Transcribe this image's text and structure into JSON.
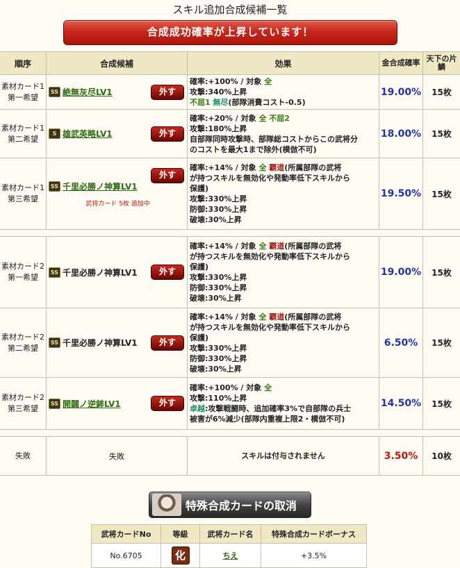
{
  "page": {
    "title": "スキル追加合成候補一覧",
    "banner": "合成成功確率が上昇しています！"
  },
  "headers": {
    "order": "順序",
    "candidate": "合成候補",
    "effect": "効果",
    "rate": "合成確率",
    "rate_prefix": "金",
    "slots": "天下の片鱗"
  },
  "rows": [
    {
      "order1": "素材カード1",
      "order2": "第一希望",
      "rank": "SS",
      "skill": "絶無灰尽LV1",
      "remove": "外す",
      "effect_lines": [
        [
          {
            "t": "確率:+100% / 対象 "
          },
          {
            "t": "全",
            "c": "g"
          }
        ],
        [
          {
            "t": "攻撃:340%上昇"
          }
        ],
        [
          {
            "t": "不屈1",
            "c": "g"
          },
          {
            "t": " "
          },
          {
            "t": "無尽",
            "c": "t"
          },
          {
            "t": "(部隊消費コスト-0.5)"
          }
        ]
      ],
      "rate": "19.00%",
      "slots": "15枚"
    },
    {
      "order1": "素材カード1",
      "order2": "第二希望",
      "rank": "S",
      "skill": "雄武英略LV1",
      "remove": "外す",
      "effect_lines": [
        [
          {
            "t": "確率:+20% / 対象 "
          },
          {
            "t": "全",
            "c": "g"
          },
          {
            "t": " "
          },
          {
            "t": "不屈2",
            "c": "g"
          }
        ],
        [
          {
            "t": "攻撃:180%上昇"
          }
        ],
        [
          {
            "t": "自部隊同時攻撃時、部隊総コストからこの武将分"
          }
        ],
        [
          {
            "t": "のコストを最大1まで除外(模倣不可)"
          }
        ]
      ],
      "rate": "18.00%",
      "slots": "15枚"
    },
    {
      "order1": "素材カード1",
      "order2": "第三希望",
      "rank": "SS",
      "skill": "千里必勝ノ神算LV1",
      "remove": "外す",
      "note": "武将カード 5枚 追加中",
      "effect_lines": [
        [
          {
            "t": "確率:+14% / 対象 "
          },
          {
            "t": "全",
            "c": "g"
          },
          {
            "t": " "
          },
          {
            "t": "覇道",
            "c": "r"
          },
          {
            "t": "(所属部隊の武将"
          }
        ],
        [
          {
            "t": "が持つスキルを無効化や発動率低下スキルから"
          }
        ],
        [
          {
            "t": "保護)"
          }
        ],
        [
          {
            "t": "攻撃:330%上昇"
          }
        ],
        [
          {
            "t": "防御:330%上昇"
          }
        ],
        [
          {
            "t": "破壊:30%上昇"
          }
        ]
      ],
      "rate": "19.50%",
      "slots": "15枚"
    },
    {
      "order1": "素材カード2",
      "order2": "第一希望",
      "rank": "SS",
      "skill": "千里必勝ノ神算LV1",
      "remove": "外す",
      "effect_lines": [
        [
          {
            "t": "確率:+14% / 対象 "
          },
          {
            "t": "全",
            "c": "g"
          },
          {
            "t": " "
          },
          {
            "t": "覇道",
            "c": "r"
          },
          {
            "t": "(所属部隊の武将"
          }
        ],
        [
          {
            "t": "が持つスキルを無効化や発動率低下スキルから"
          }
        ],
        [
          {
            "t": "保護)"
          }
        ],
        [
          {
            "t": "攻撃:330%上昇"
          }
        ],
        [
          {
            "t": "防御:330%上昇"
          }
        ],
        [
          {
            "t": "破壊:30%上昇"
          }
        ]
      ],
      "rate": "19.00%",
      "slots": "15枚"
    },
    {
      "order1": "素材カード2",
      "order2": "第二希望",
      "rank": "SS",
      "skill": "千里必勝ノ神算LV1",
      "remove": "外す",
      "effect_lines": [
        [
          {
            "t": "確率:+14% / 対象 "
          },
          {
            "t": "全",
            "c": "g"
          },
          {
            "t": " "
          },
          {
            "t": "覇道",
            "c": "r"
          },
          {
            "t": "(所属部隊の武将"
          }
        ],
        [
          {
            "t": "が持つスキルを無効化や発動率低下スキルから"
          }
        ],
        [
          {
            "t": "保護)"
          }
        ],
        [
          {
            "t": "攻撃:330%上昇"
          }
        ],
        [
          {
            "t": "防御:330%上昇"
          }
        ],
        [
          {
            "t": "破壊:30%上昇"
          }
        ]
      ],
      "rate": "6.50%",
      "slots": "15枚"
    },
    {
      "order1": "素材カード2",
      "order2": "第三希望",
      "rank": "SS",
      "skill": "開闢ノ逆鉾LV1",
      "remove": "外す",
      "effect_lines": [
        [
          {
            "t": "確率:+100% / 対象 "
          },
          {
            "t": "全",
            "c": "g"
          }
        ],
        [
          {
            "t": "攻撃:110%上昇"
          }
        ],
        [
          {
            "t": "卓越",
            "c": "t"
          },
          {
            "t": ":攻撃戦闘時、追加確率3%で自部隊の兵士"
          }
        ],
        [
          {
            "t": "被害が6%減少(部隊内重複上限2・模倣不可)"
          }
        ]
      ],
      "rate": "14.50%",
      "slots": "15枚"
    }
  ],
  "fail_row": {
    "order": "失敗",
    "candidate": "失敗",
    "effect": "スキルは付与されません",
    "rate": "3.50%",
    "slots": "10枚"
  },
  "cancel_button": {
    "label": "特殊合成カードの取消"
  },
  "card_table": {
    "headers": [
      "武将カードNo",
      "等級",
      "武将カード名",
      "特殊合成カードボーナス"
    ],
    "row": {
      "no": "No.6705",
      "grade": "化",
      "name": "ちえ",
      "bonus": "+3.5%"
    }
  }
}
